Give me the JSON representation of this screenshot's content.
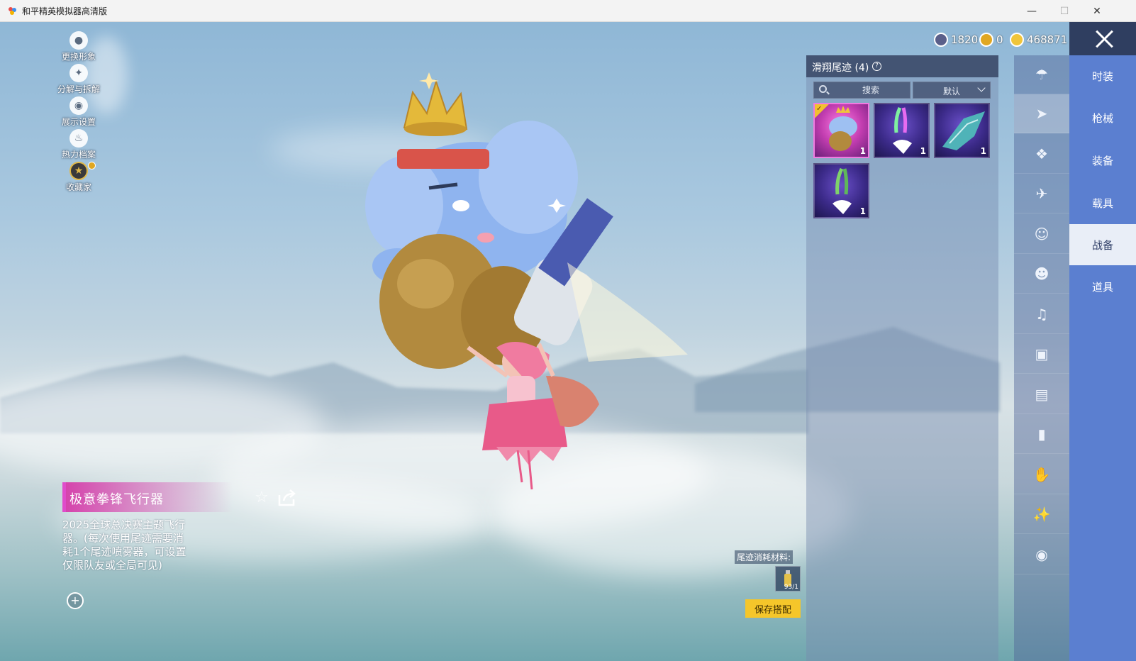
{
  "window": {
    "title": "和平精英模拟器高清版",
    "minimize": "—",
    "maximize": "☐",
    "close": "✕"
  },
  "left_menu": [
    {
      "label": "更换形象",
      "icon": "person-icon"
    },
    {
      "label": "分解与拆解",
      "icon": "puzzle-icon"
    },
    {
      "label": "展示设置",
      "icon": "eye-icon"
    },
    {
      "label": "热力档案",
      "icon": "fire-icon"
    },
    {
      "label": "收藏家",
      "icon": "collector-badge-icon"
    }
  ],
  "item": {
    "name": "极意拳锋飞行器",
    "description": "2025全球总决赛主题飞行器。(每次使用尾迹需要消耗1个尾迹喷雾器，可设置仅限队友或全局可见)",
    "zoom_glyph": "+",
    "favorite_glyph": "☆"
  },
  "currency": [
    {
      "value": "1820",
      "color": "#5a5f8a"
    },
    {
      "value": "0",
      "color": "#e0a722"
    },
    {
      "value": "468871",
      "color": "#f0c53a"
    }
  ],
  "panel": {
    "title": "滑翔尾迹 (4)",
    "help": "?",
    "search_placeholder": "搜索",
    "sort_label": "默认",
    "cards": [
      {
        "count": "1",
        "rarity": "pink",
        "equipped": true,
        "name": "elephant-glider"
      },
      {
        "count": "1",
        "rarity": "purple",
        "equipped": false,
        "name": "rainbow-smoke-trail"
      },
      {
        "count": "1",
        "rarity": "purple",
        "equipped": false,
        "name": "mech-wing-glider"
      },
      {
        "count": "1",
        "rarity": "purple",
        "equipped": false,
        "name": "green-smoke-trail"
      }
    ],
    "equipped_glyph": "✓"
  },
  "categories": [
    {
      "icon": "parachute-icon",
      "active": false
    },
    {
      "icon": "glider-trail-icon",
      "active": true
    },
    {
      "icon": "drone-icon",
      "active": false
    },
    {
      "icon": "airplane-icon",
      "active": false
    },
    {
      "icon": "emote-face-icon",
      "active": false
    },
    {
      "icon": "companion-icon",
      "active": false
    },
    {
      "icon": "speaker-icon",
      "active": false
    },
    {
      "icon": "tv-icon",
      "active": false
    },
    {
      "icon": "picture-icon",
      "active": false
    },
    {
      "icon": "spray-icon",
      "active": false
    },
    {
      "icon": "hand-gesture-icon",
      "active": false
    },
    {
      "icon": "sparkle-wand-icon",
      "active": false
    },
    {
      "icon": "pan-icon",
      "active": false
    }
  ],
  "tabs": [
    {
      "label": "时装",
      "active": false
    },
    {
      "label": "枪械",
      "active": false
    },
    {
      "label": "装备",
      "active": false
    },
    {
      "label": "载具",
      "active": false
    },
    {
      "label": "战备",
      "active": true
    },
    {
      "label": "道具",
      "active": false
    }
  ],
  "material": {
    "label": "尾迹消耗材料:",
    "count": "93/1"
  },
  "save_label": "保存搭配",
  "colors": {
    "tab_column": "#5b7fd0",
    "save_button": "#f5c62a",
    "title_accent": "#e04ccb"
  }
}
